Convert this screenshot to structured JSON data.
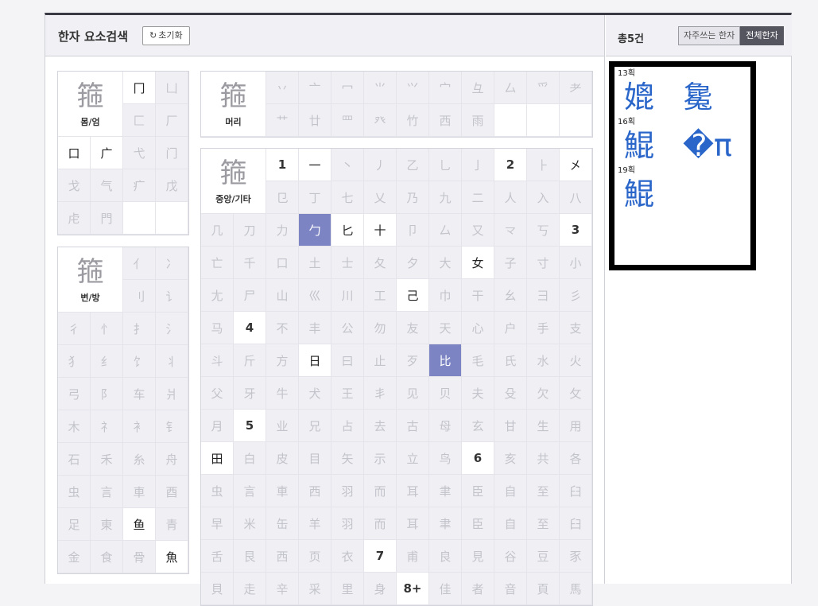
{
  "header": {
    "title": "한자 요소검색",
    "reset_label": "초기화"
  },
  "results_header": {
    "count_label": "총5건",
    "toggle_frequent": "자주쓰는 한자",
    "toggle_all": "전체한자"
  },
  "categories": {
    "enclosure": {
      "label": "몸/엄",
      "glyph_pre": "箍",
      "glyph_hl": "",
      "cells": [
        {
          "t": "冂",
          "s": "active"
        },
        {
          "t": "凵",
          "s": "disabled"
        },
        {
          "t": "匚",
          "s": "disabled"
        },
        {
          "t": "厂",
          "s": "disabled"
        },
        {
          "t": "口",
          "s": "active"
        },
        {
          "t": "广",
          "s": "active"
        },
        {
          "t": "弋",
          "s": "disabled"
        },
        {
          "t": "门",
          "s": "disabled"
        },
        {
          "t": "戈",
          "s": "disabled"
        },
        {
          "t": "气",
          "s": "disabled"
        },
        {
          "t": "疒",
          "s": "disabled"
        },
        {
          "t": "戊",
          "s": "disabled"
        },
        {
          "t": "虍",
          "s": "disabled"
        },
        {
          "t": "門",
          "s": "disabled"
        },
        {
          "t": "",
          "s": "blank"
        },
        {
          "t": "",
          "s": "blank"
        }
      ]
    },
    "side": {
      "label": "변/방",
      "glyph_pre": "箍",
      "cells": [
        {
          "t": "亻",
          "s": "disabled"
        },
        {
          "t": "冫",
          "s": "disabled"
        },
        {
          "t": "刂",
          "s": "disabled"
        },
        {
          "t": "讠",
          "s": "disabled"
        },
        {
          "t": "彳",
          "s": "disabled"
        },
        {
          "t": "忄",
          "s": "disabled"
        },
        {
          "t": "扌",
          "s": "disabled"
        },
        {
          "t": "氵",
          "s": "disabled"
        },
        {
          "t": "犭",
          "s": "disabled"
        },
        {
          "t": "纟",
          "s": "disabled"
        },
        {
          "t": "饣",
          "s": "disabled"
        },
        {
          "t": "丬",
          "s": "disabled"
        },
        {
          "t": "弓",
          "s": "disabled"
        },
        {
          "t": "阝",
          "s": "disabled"
        },
        {
          "t": "车",
          "s": "disabled"
        },
        {
          "t": "爿",
          "s": "disabled"
        },
        {
          "t": "木",
          "s": "disabled"
        },
        {
          "t": "礻",
          "s": "disabled"
        },
        {
          "t": "衤",
          "s": "disabled"
        },
        {
          "t": "钅",
          "s": "disabled"
        },
        {
          "t": "石",
          "s": "disabled"
        },
        {
          "t": "禾",
          "s": "disabled"
        },
        {
          "t": "糸",
          "s": "disabled"
        },
        {
          "t": "舟",
          "s": "disabled"
        },
        {
          "t": "虫",
          "s": "disabled"
        },
        {
          "t": "言",
          "s": "disabled"
        },
        {
          "t": "車",
          "s": "disabled"
        },
        {
          "t": "酉",
          "s": "disabled"
        },
        {
          "t": "足",
          "s": "disabled"
        },
        {
          "t": "東",
          "s": "disabled"
        },
        {
          "t": "鱼",
          "s": "active"
        },
        {
          "t": "青",
          "s": "disabled"
        },
        {
          "t": "金",
          "s": "disabled"
        },
        {
          "t": "食",
          "s": "disabled"
        },
        {
          "t": "骨",
          "s": "disabled"
        },
        {
          "t": "魚",
          "s": "active"
        }
      ]
    },
    "head": {
      "label": "머리",
      "glyph_pre": "箍",
      "cells": [
        {
          "t": "丷",
          "s": "disabled"
        },
        {
          "t": "亠",
          "s": "disabled"
        },
        {
          "t": "冖",
          "s": "disabled"
        },
        {
          "t": "⺌",
          "s": "disabled"
        },
        {
          "t": "⺍",
          "s": "disabled"
        },
        {
          "t": "宀",
          "s": "disabled"
        },
        {
          "t": "彑",
          "s": "disabled"
        },
        {
          "t": "厶",
          "s": "disabled"
        },
        {
          "t": "爫",
          "s": "disabled"
        },
        {
          "t": "耂",
          "s": "disabled"
        },
        {
          "t": "艹",
          "s": "disabled"
        },
        {
          "t": "廿",
          "s": "disabled"
        },
        {
          "t": "罒",
          "s": "disabled"
        },
        {
          "t": "癶",
          "s": "disabled"
        },
        {
          "t": "竹",
          "s": "disabled"
        },
        {
          "t": "西",
          "s": "disabled"
        },
        {
          "t": "雨",
          "s": "disabled"
        },
        {
          "t": "",
          "s": "blank"
        },
        {
          "t": "",
          "s": "blank"
        },
        {
          "t": "",
          "s": "blank"
        }
      ]
    },
    "middle": {
      "label": "중앙/기타",
      "glyph_pre": "箍",
      "cells": [
        {
          "t": "1",
          "s": "num"
        },
        {
          "t": "一",
          "s": "active"
        },
        {
          "t": "丶",
          "s": "disabled"
        },
        {
          "t": "丿",
          "s": "disabled"
        },
        {
          "t": "乙",
          "s": "disabled"
        },
        {
          "t": "乚",
          "s": "disabled"
        },
        {
          "t": "亅",
          "s": "disabled"
        },
        {
          "t": "2",
          "s": "num"
        },
        {
          "t": "⺊",
          "s": "disabled"
        },
        {
          "t": "㐅",
          "s": "active"
        },
        {
          "t": "㔾",
          "s": "disabled"
        },
        {
          "t": "丁",
          "s": "disabled"
        },
        {
          "t": "七",
          "s": "disabled"
        },
        {
          "t": "乂",
          "s": "disabled"
        },
        {
          "t": "乃",
          "s": "disabled"
        },
        {
          "t": "九",
          "s": "disabled"
        },
        {
          "t": "二",
          "s": "disabled"
        },
        {
          "t": "人",
          "s": "disabled"
        },
        {
          "t": "入",
          "s": "disabled"
        },
        {
          "t": "八",
          "s": "disabled"
        },
        {
          "t": "几",
          "s": "disabled"
        },
        {
          "t": "刀",
          "s": "disabled"
        },
        {
          "t": "力",
          "s": "disabled"
        },
        {
          "t": "勹",
          "s": "selected"
        },
        {
          "t": "匕",
          "s": "active"
        },
        {
          "t": "十",
          "s": "active"
        },
        {
          "t": "卩",
          "s": "disabled"
        },
        {
          "t": "厶",
          "s": "disabled"
        },
        {
          "t": "又",
          "s": "disabled"
        },
        {
          "t": "龴",
          "s": "disabled"
        },
        {
          "t": "丂",
          "s": "disabled"
        },
        {
          "t": "3",
          "s": "num"
        },
        {
          "t": "亡",
          "s": "disabled"
        },
        {
          "t": "千",
          "s": "disabled"
        },
        {
          "t": "口",
          "s": "disabled"
        },
        {
          "t": "土",
          "s": "disabled"
        },
        {
          "t": "士",
          "s": "disabled"
        },
        {
          "t": "夂",
          "s": "disabled"
        },
        {
          "t": "夕",
          "s": "disabled"
        },
        {
          "t": "大",
          "s": "disabled"
        },
        {
          "t": "女",
          "s": "active"
        },
        {
          "t": "子",
          "s": "disabled"
        },
        {
          "t": "寸",
          "s": "disabled"
        },
        {
          "t": "小",
          "s": "disabled"
        },
        {
          "t": "尢",
          "s": "disabled"
        },
        {
          "t": "尸",
          "s": "disabled"
        },
        {
          "t": "山",
          "s": "disabled"
        },
        {
          "t": "巛",
          "s": "disabled"
        },
        {
          "t": "川",
          "s": "disabled"
        },
        {
          "t": "工",
          "s": "disabled"
        },
        {
          "t": "己",
          "s": "active"
        },
        {
          "t": "巾",
          "s": "disabled"
        },
        {
          "t": "干",
          "s": "disabled"
        },
        {
          "t": "幺",
          "s": "disabled"
        },
        {
          "t": "彐",
          "s": "disabled"
        },
        {
          "t": "彡",
          "s": "disabled"
        },
        {
          "t": "马",
          "s": "disabled"
        },
        {
          "t": "4",
          "s": "num"
        },
        {
          "t": "不",
          "s": "disabled"
        },
        {
          "t": "丰",
          "s": "disabled"
        },
        {
          "t": "公",
          "s": "disabled"
        },
        {
          "t": "勿",
          "s": "disabled"
        },
        {
          "t": "友",
          "s": "disabled"
        },
        {
          "t": "天",
          "s": "disabled"
        },
        {
          "t": "心",
          "s": "disabled"
        },
        {
          "t": "户",
          "s": "disabled"
        },
        {
          "t": "手",
          "s": "disabled"
        },
        {
          "t": "支",
          "s": "disabled"
        },
        {
          "t": "斗",
          "s": "disabled"
        },
        {
          "t": "斤",
          "s": "disabled"
        },
        {
          "t": "方",
          "s": "disabled"
        },
        {
          "t": "日",
          "s": "active"
        },
        {
          "t": "曰",
          "s": "disabled"
        },
        {
          "t": "止",
          "s": "disabled"
        },
        {
          "t": "歹",
          "s": "disabled"
        },
        {
          "t": "比",
          "s": "selected"
        },
        {
          "t": "毛",
          "s": "disabled"
        },
        {
          "t": "氏",
          "s": "disabled"
        },
        {
          "t": "水",
          "s": "disabled"
        },
        {
          "t": "火",
          "s": "disabled"
        },
        {
          "t": "父",
          "s": "disabled"
        },
        {
          "t": "牙",
          "s": "disabled"
        },
        {
          "t": "牛",
          "s": "disabled"
        },
        {
          "t": "犬",
          "s": "disabled"
        },
        {
          "t": "王",
          "s": "disabled"
        },
        {
          "t": "丯",
          "s": "disabled"
        },
        {
          "t": "见",
          "s": "disabled"
        },
        {
          "t": "贝",
          "s": "disabled"
        },
        {
          "t": "夫",
          "s": "disabled"
        },
        {
          "t": "殳",
          "s": "disabled"
        },
        {
          "t": "欠",
          "s": "disabled"
        },
        {
          "t": "攵",
          "s": "disabled"
        },
        {
          "t": "月",
          "s": "disabled"
        },
        {
          "t": "5",
          "s": "num"
        },
        {
          "t": "业",
          "s": "disabled"
        },
        {
          "t": "兄",
          "s": "disabled"
        },
        {
          "t": "占",
          "s": "disabled"
        },
        {
          "t": "去",
          "s": "disabled"
        },
        {
          "t": "古",
          "s": "disabled"
        },
        {
          "t": "母",
          "s": "disabled"
        },
        {
          "t": "玄",
          "s": "disabled"
        },
        {
          "t": "甘",
          "s": "disabled"
        },
        {
          "t": "生",
          "s": "disabled"
        },
        {
          "t": "用",
          "s": "disabled"
        },
        {
          "t": "田",
          "s": "active"
        },
        {
          "t": "白",
          "s": "disabled"
        },
        {
          "t": "皮",
          "s": "disabled"
        },
        {
          "t": "目",
          "s": "disabled"
        },
        {
          "t": "矢",
          "s": "disabled"
        },
        {
          "t": "示",
          "s": "disabled"
        },
        {
          "t": "立",
          "s": "disabled"
        },
        {
          "t": "鸟",
          "s": "disabled"
        },
        {
          "t": "6",
          "s": "num"
        },
        {
          "t": "亥",
          "s": "disabled"
        },
        {
          "t": "共",
          "s": "disabled"
        },
        {
          "t": "各",
          "s": "disabled"
        },
        {
          "t": "虫",
          "s": "disabled"
        },
        {
          "t": "言",
          "s": "disabled"
        },
        {
          "t": "車",
          "s": "disabled"
        },
        {
          "t": "西",
          "s": "disabled"
        },
        {
          "t": "羽",
          "s": "disabled"
        },
        {
          "t": "而",
          "s": "disabled"
        },
        {
          "t": "耳",
          "s": "disabled"
        },
        {
          "t": "聿",
          "s": "disabled"
        },
        {
          "t": "臣",
          "s": "disabled"
        },
        {
          "t": "自",
          "s": "disabled"
        },
        {
          "t": "至",
          "s": "disabled"
        },
        {
          "t": "臼",
          "s": "disabled"
        },
        {
          "t": "早",
          "s": "disabled"
        },
        {
          "t": "米",
          "s": "disabled"
        },
        {
          "t": "缶",
          "s": "disabled"
        },
        {
          "t": "羊",
          "s": "disabled"
        },
        {
          "t": "羽",
          "s": "disabled"
        },
        {
          "t": "而",
          "s": "disabled"
        },
        {
          "t": "耳",
          "s": "disabled"
        },
        {
          "t": "聿",
          "s": "disabled"
        },
        {
          "t": "臣",
          "s": "disabled"
        },
        {
          "t": "自",
          "s": "disabled"
        },
        {
          "t": "至",
          "s": "disabled"
        },
        {
          "t": "臼",
          "s": "disabled"
        },
        {
          "t": "舌",
          "s": "disabled"
        },
        {
          "t": "艮",
          "s": "disabled"
        },
        {
          "t": "西",
          "s": "disabled"
        },
        {
          "t": "页",
          "s": "disabled"
        },
        {
          "t": "衣",
          "s": "disabled"
        },
        {
          "t": "7",
          "s": "num"
        },
        {
          "t": "甫",
          "s": "disabled"
        },
        {
          "t": "良",
          "s": "disabled"
        },
        {
          "t": "見",
          "s": "disabled"
        },
        {
          "t": "谷",
          "s": "disabled"
        },
        {
          "t": "豆",
          "s": "disabled"
        },
        {
          "t": "豕",
          "s": "disabled"
        },
        {
          "t": "貝",
          "s": "disabled"
        },
        {
          "t": "走",
          "s": "disabled"
        },
        {
          "t": "辛",
          "s": "disabled"
        },
        {
          "t": "采",
          "s": "disabled"
        },
        {
          "t": "里",
          "s": "disabled"
        },
        {
          "t": "身",
          "s": "disabled"
        },
        {
          "t": "8+",
          "s": "num"
        },
        {
          "t": "佳",
          "s": "disabled"
        },
        {
          "t": "者",
          "s": "disabled"
        },
        {
          "t": "音",
          "s": "disabled"
        },
        {
          "t": "頁",
          "s": "disabled"
        },
        {
          "t": "馬",
          "s": "disabled"
        }
      ]
    }
  },
  "results": [
    {
      "strokes": "13획",
      "chars": [
        "媲",
        "毚"
      ]
    },
    {
      "strokes": "16획",
      "chars": [
        "鯤",
        "�π"
      ]
    },
    {
      "strokes": "19획",
      "chars": [
        "鯤"
      ]
    }
  ]
}
